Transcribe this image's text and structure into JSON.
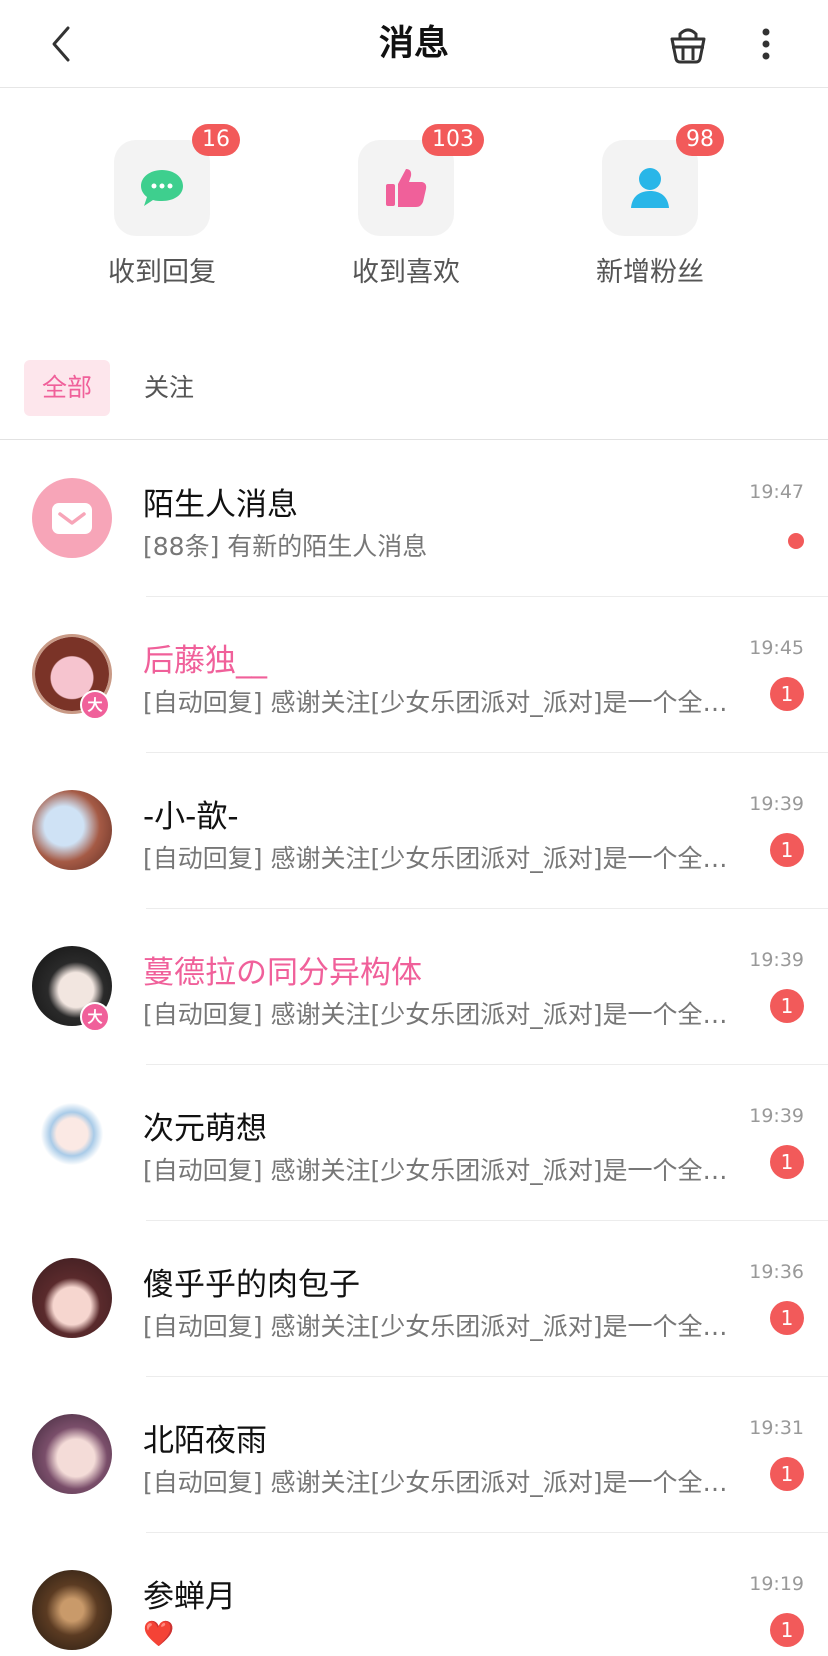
{
  "header": {
    "title": "消息"
  },
  "quick_actions": [
    {
      "label": "收到回复",
      "badge": "16",
      "icon": "chat-bubble-icon",
      "color": "#3ecf8e"
    },
    {
      "label": "收到喜欢",
      "badge": "103",
      "icon": "thumbs-up-icon",
      "color": "#f0609a"
    },
    {
      "label": "新增粉丝",
      "badge": "98",
      "icon": "user-icon",
      "color": "#29b6e8"
    }
  ],
  "tabs": [
    {
      "label": "全部",
      "active": true
    },
    {
      "label": "关注",
      "active": false
    }
  ],
  "conversations": [
    {
      "name": "陌生人消息",
      "preview": "[88条] 有新的陌生人消息",
      "time": "19:47",
      "unread": "",
      "name_color": "default",
      "vip": false
    },
    {
      "name": "后藤独__",
      "preview": "[自动回复] 感谢关注[少女乐团派对_派对]是一个全新的少女乐团手游",
      "time": "19:45",
      "unread": "1",
      "name_color": "pink",
      "vip": true
    },
    {
      "name": "-小-歆-",
      "preview": "[自动回复] 感谢关注[少女乐团派对_派对]是一个全新的少女乐团手游",
      "time": "19:39",
      "unread": "1",
      "name_color": "default",
      "vip": false
    },
    {
      "name": "蔓德拉の同分异构体",
      "preview": "[自动回复] 感谢关注[少女乐团派对_派对]是一个全新的少女乐团手游",
      "time": "19:39",
      "unread": "1",
      "name_color": "pink",
      "vip": true
    },
    {
      "name": "次元萌想",
      "preview": "[自动回复] 感谢关注[少女乐团派对_派对]是一个全新的少女乐团手游",
      "time": "19:39",
      "unread": "1",
      "name_color": "default",
      "vip": false
    },
    {
      "name": "傻乎乎的肉包子",
      "preview": "[自动回复] 感谢关注[少女乐团派对_派对]是一个全新的少女乐团手游",
      "time": "19:36",
      "unread": "1",
      "name_color": "default",
      "vip": false
    },
    {
      "name": "北陌夜雨",
      "preview": "[自动回复] 感谢关注[少女乐团派对_派对]是一个全新的少女乐团手游",
      "time": "19:31",
      "unread": "1",
      "name_color": "default",
      "vip": false
    },
    {
      "name": "参蝉月",
      "preview": "❤️",
      "time": "19:19",
      "unread": "1",
      "name_color": "default",
      "vip": false
    }
  ],
  "vip_badge": "大",
  "colors": {
    "accent_pink": "#f0609a",
    "badge_red": "#f25a5a"
  }
}
